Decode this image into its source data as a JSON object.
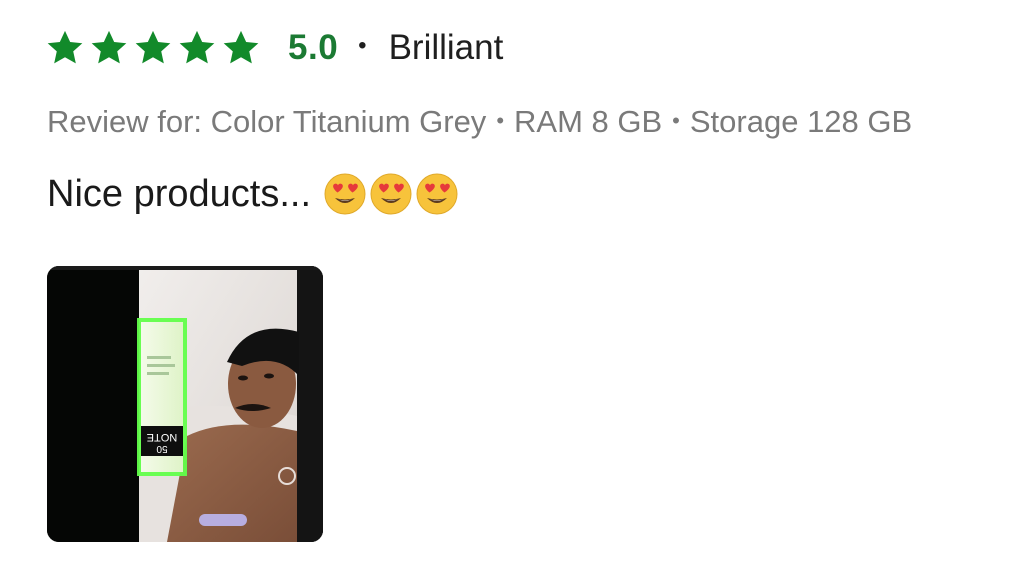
{
  "review": {
    "rating": 5,
    "score": "5.0",
    "separator": "•",
    "verdict": "Brilliant",
    "variant": {
      "prefix": "Review for:",
      "color": "Color Titanium Grey",
      "ram": "RAM 8 GB",
      "storage": "Storage 128 GB",
      "separator": "•"
    },
    "text": "Nice products...",
    "emoji_count": 3,
    "emoji": "smiling-face-with-heart-eyes"
  },
  "colors": {
    "star": "#128a2a",
    "score": "#1b7a33",
    "muted": "#7a7a7a",
    "text": "#1a1a1a"
  },
  "photo": {
    "product_box_text": [
      "NOTE",
      "50"
    ]
  }
}
